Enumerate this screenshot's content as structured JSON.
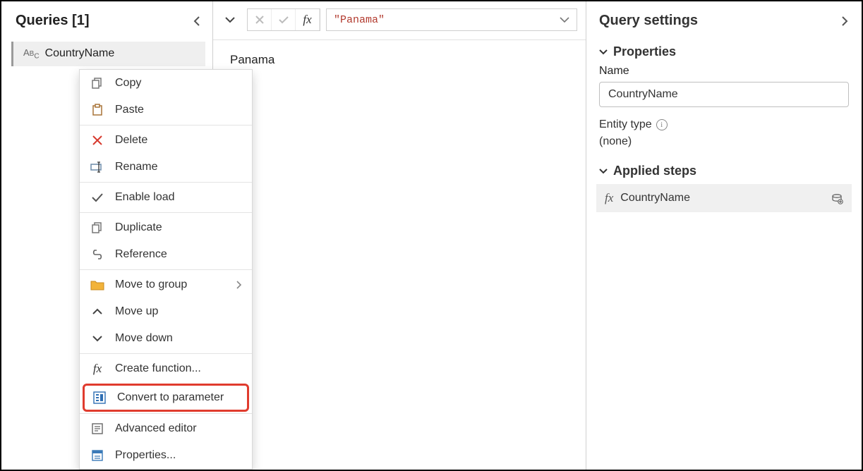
{
  "queries_panel": {
    "title": "Queries [1]",
    "item": {
      "icon_text": "ABC",
      "label": "CountryName"
    }
  },
  "context_menu": {
    "copy": "Copy",
    "paste": "Paste",
    "delete": "Delete",
    "rename": "Rename",
    "enable_load": "Enable load",
    "duplicate": "Duplicate",
    "reference": "Reference",
    "move_to_group": "Move to group",
    "move_up": "Move up",
    "move_down": "Move down",
    "create_function": "Create function...",
    "convert_to_parameter": "Convert to parameter",
    "advanced_editor": "Advanced editor",
    "properties": "Properties..."
  },
  "formula_bar": {
    "text": "\"Panama\""
  },
  "preview": {
    "value": "Panama"
  },
  "settings": {
    "title": "Query settings",
    "properties_label": "Properties",
    "name_label": "Name",
    "name_value": "CountryName",
    "entity_type_label": "Entity type",
    "entity_type_value": "(none)",
    "applied_steps_label": "Applied steps",
    "step1": "CountryName"
  }
}
